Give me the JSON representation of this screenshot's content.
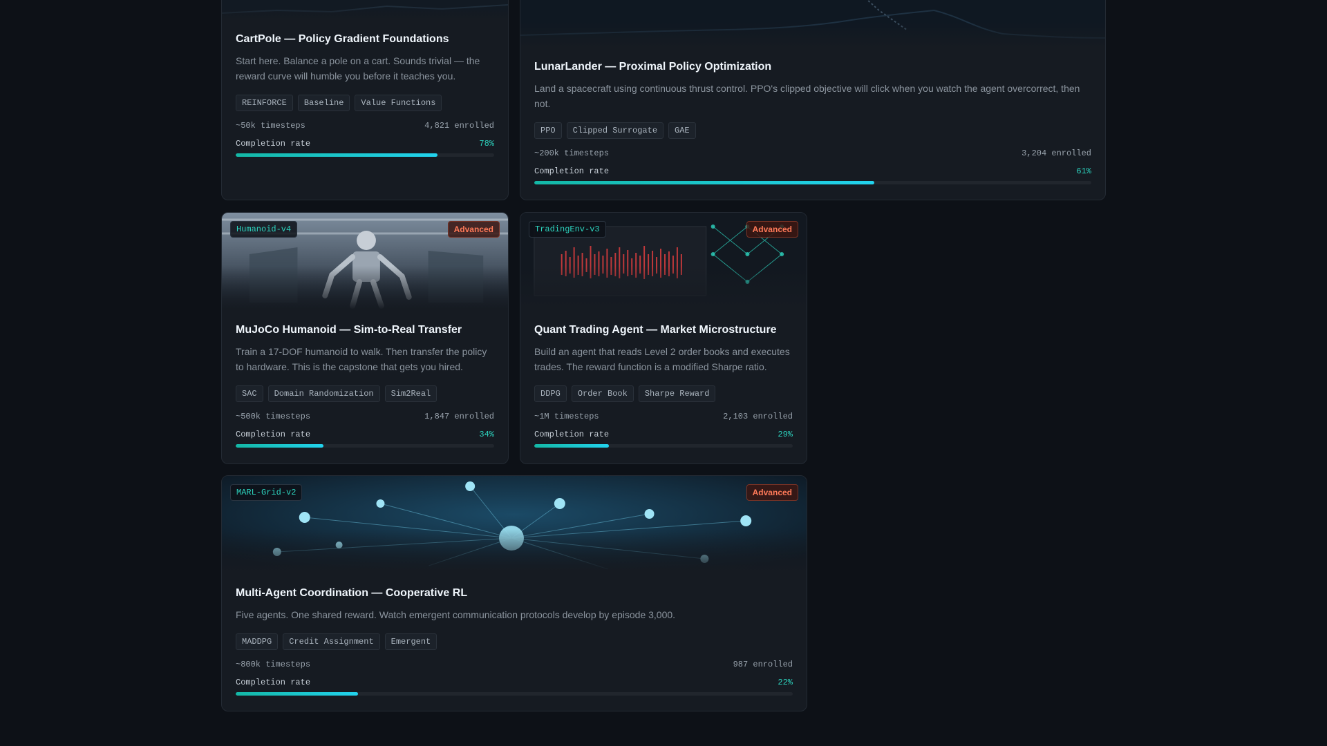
{
  "courses": [
    {
      "title": "CartPole — Policy Gradient Foundations",
      "description": "Start here. Balance a pole on a cart. Sounds trivial — the reward curve will humble you before it teaches you.",
      "tags": [
        "REINFORCE",
        "Baseline",
        "Value Functions"
      ],
      "timesteps": "~50k timesteps",
      "enrolled": "4,821 enrolled",
      "completion_label": "Completion rate",
      "completion": "78%",
      "completion_fraction": 0.78
    },
    {
      "title": "LunarLander — Proximal Policy Optimization",
      "description": "Land a spacecraft using continuous thrust control. PPO's clipped objective will click when you watch the agent overcorrect, then not.",
      "tags": [
        "PPO",
        "Clipped Surrogate",
        "GAE"
      ],
      "timesteps": "~200k timesteps",
      "enrolled": "3,204 enrolled",
      "completion_label": "Completion rate",
      "completion": "61%",
      "completion_fraction": 0.61
    },
    {
      "env": "Humanoid-v4",
      "level": "Advanced",
      "title": "MuJoCo Humanoid — Sim-to-Real Transfer",
      "description": "Train a 17-DOF humanoid to walk. Then transfer the policy to hardware. This is the capstone that gets you hired.",
      "tags": [
        "SAC",
        "Domain Randomization",
        "Sim2Real"
      ],
      "timesteps": "~500k timesteps",
      "enrolled": "1,847 enrolled",
      "completion_label": "Completion rate",
      "completion": "34%",
      "completion_fraction": 0.34
    },
    {
      "env": "TradingEnv-v3",
      "level": "Advanced",
      "title": "Quant Trading Agent — Market Microstructure",
      "description": "Build an agent that reads Level 2 order books and executes trades. The reward function is a modified Sharpe ratio.",
      "tags": [
        "DDPG",
        "Order Book",
        "Sharpe Reward"
      ],
      "timesteps": "~1M timesteps",
      "enrolled": "2,103 enrolled",
      "completion_label": "Completion rate",
      "completion": "29%",
      "completion_fraction": 0.29
    },
    {
      "env": "MARL-Grid-v2",
      "level": "Advanced",
      "title": "Multi-Agent Coordination — Cooperative RL",
      "description": "Five agents. One shared reward. Watch emergent communication protocols develop by episode 3,000.",
      "tags": [
        "MADDPG",
        "Credit Assignment",
        "Emergent"
      ],
      "timesteps": "~800k timesteps",
      "enrolled": "987 enrolled",
      "completion_label": "Completion rate",
      "completion": "22%",
      "completion_fraction": 0.22
    }
  ],
  "colors": {
    "accent": "#2dd4bf",
    "advanced": "#ff7a59",
    "card": "#161b22",
    "page": "#0d1117"
  }
}
